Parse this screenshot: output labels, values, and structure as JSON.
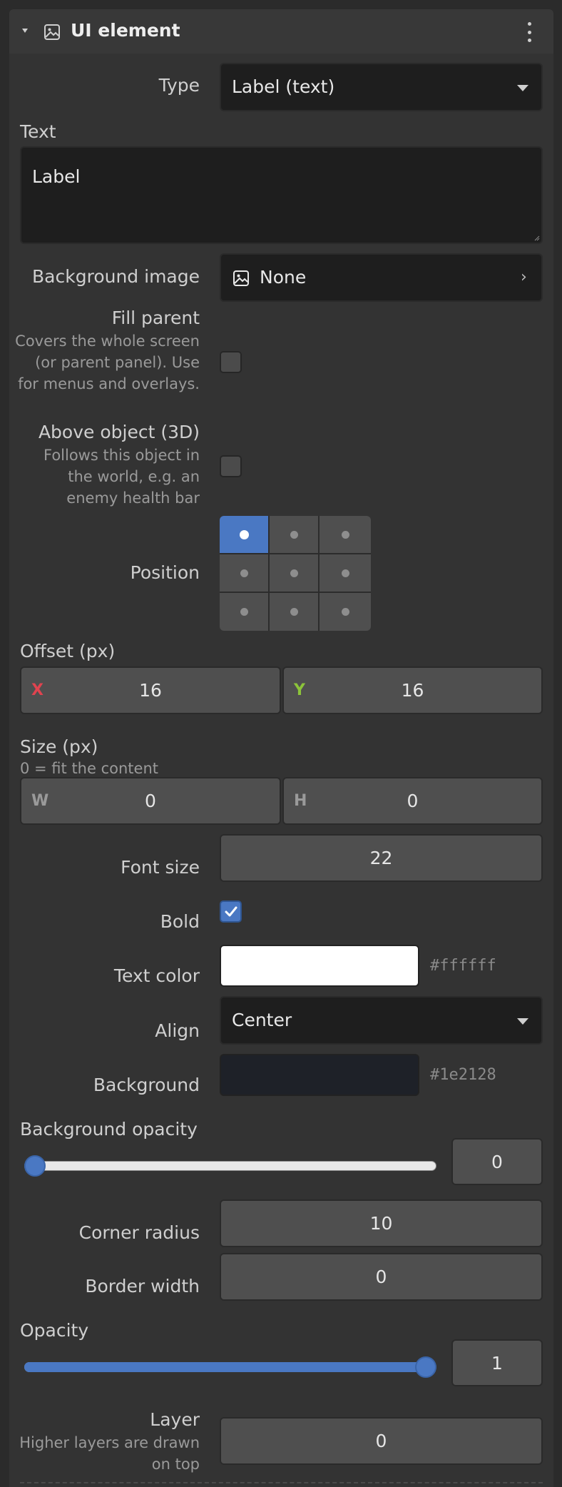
{
  "header": {
    "title": "UI element",
    "collapse_icon": "triangle-down-icon",
    "image_icon": "image-icon",
    "menu_icon": "kebab-menu-icon"
  },
  "type": {
    "label": "Type",
    "value": "Label (text)"
  },
  "text": {
    "label": "Text",
    "value": "Label"
  },
  "background_image": {
    "label": "Background image",
    "value": "None"
  },
  "fill_parent": {
    "label": "Fill parent",
    "hint": "Covers the whole screen (or parent panel). Use for menus and overlays.",
    "checked": false
  },
  "above_object": {
    "label": "Above object (3D)",
    "hint": "Follows this object in the world, e.g. an enemy health bar",
    "checked": false
  },
  "position": {
    "label": "Position",
    "selected": "top-left"
  },
  "offset": {
    "label": "Offset (px)",
    "x_label": "X",
    "x": "16",
    "y_label": "Y",
    "y": "16"
  },
  "size": {
    "label": "Size (px)",
    "hint": "0 = fit the content",
    "w_label": "W",
    "w": "0",
    "h_label": "H",
    "h": "0"
  },
  "font_size": {
    "label": "Font size",
    "value": "22"
  },
  "bold": {
    "label": "Bold",
    "checked": true
  },
  "text_color": {
    "label": "Text color",
    "value": "#ffffff"
  },
  "align": {
    "label": "Align",
    "value": "Center"
  },
  "background": {
    "label": "Background",
    "value": "#1e2128"
  },
  "background_opacity": {
    "label": "Background opacity",
    "value": "0",
    "fraction": 0
  },
  "corner_radius": {
    "label": "Corner radius",
    "value": "10"
  },
  "border_width": {
    "label": "Border width",
    "value": "0"
  },
  "opacity": {
    "label": "Opacity",
    "value": "1",
    "fraction": 1
  },
  "layer": {
    "label": "Layer",
    "hint": "Higher layers are drawn on top",
    "value": "0"
  },
  "colors": {
    "accent": "#4a78c3",
    "x_axis": "#e0434f",
    "y_axis": "#8cc43a"
  }
}
